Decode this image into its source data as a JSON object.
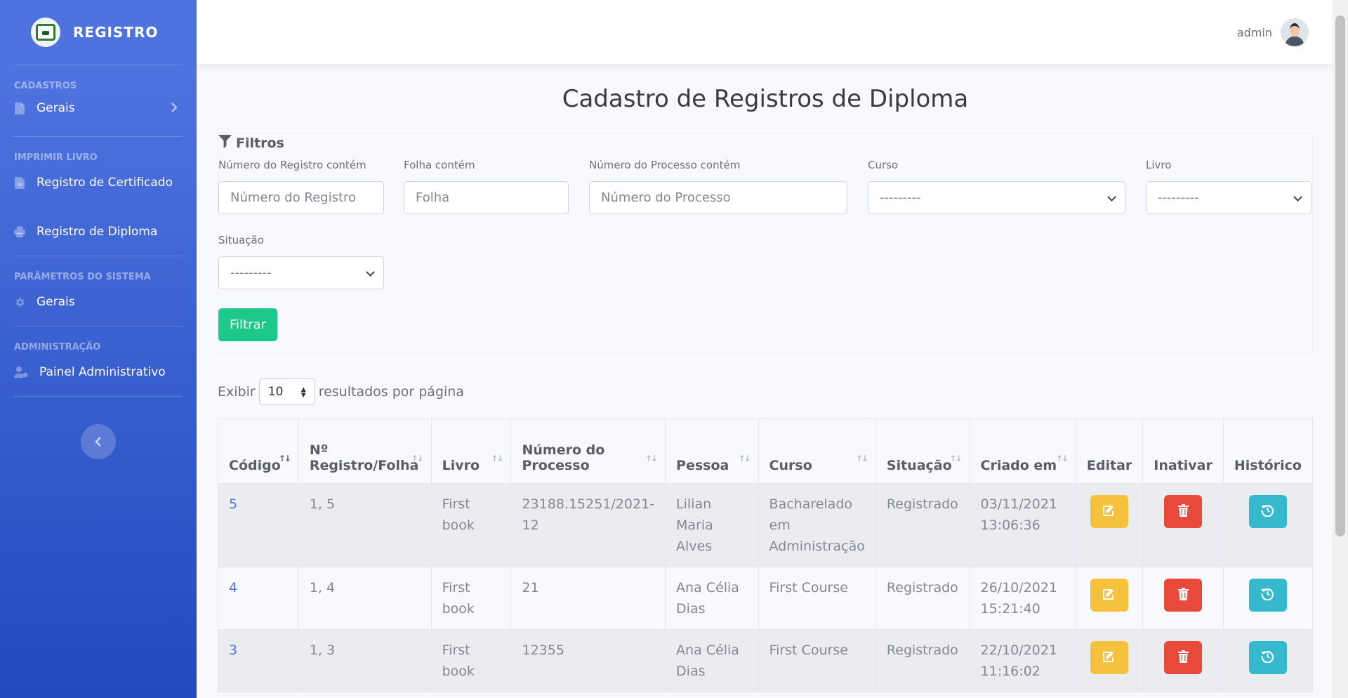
{
  "brand": {
    "name": "REGISTRO"
  },
  "sidebar": {
    "sections": [
      {
        "heading": "CADASTROS",
        "items": [
          {
            "label": "Gerais",
            "icon": "file-icon",
            "has_arrow": true
          }
        ]
      },
      {
        "heading": "IMPRIMIR LIVRO",
        "items": [
          {
            "label": "Registro de Certificado",
            "icon": "file-pdf-icon"
          },
          {
            "label": "Registro de Diploma",
            "icon": "print-icon"
          }
        ]
      },
      {
        "heading": "PARÂMETROS DO SISTEMA",
        "items": [
          {
            "label": "Gerais",
            "icon": "gear-icon"
          }
        ]
      },
      {
        "heading": "ADMINISTRAÇÃO",
        "items": [
          {
            "label": "Painel Administrativo",
            "icon": "user-cog-icon"
          }
        ]
      }
    ],
    "toggle_icon": "chevron-left-icon"
  },
  "topbar": {
    "user_name": "admin"
  },
  "page": {
    "title": "Cadastro de Registros de Diploma"
  },
  "filters": {
    "title": "Filtros",
    "numero_registro": {
      "label": "Número do Registro contém",
      "placeholder": "Número do Registro"
    },
    "folha": {
      "label": "Folha contém",
      "placeholder": "Folha"
    },
    "numero_processo": {
      "label": "Número do Processo contém",
      "placeholder": "Número do Processo"
    },
    "curso": {
      "label": "Curso",
      "value": "---------"
    },
    "livro": {
      "label": "Livro",
      "value": "---------"
    },
    "situacao": {
      "label": "Situação",
      "value": "---------"
    },
    "submit_label": "Filtrar"
  },
  "length": {
    "prefix": "Exibir",
    "value": "10",
    "suffix": "resultados por página"
  },
  "table": {
    "headers": {
      "codigo": "Código",
      "registro_1": "Nº",
      "registro_2": "Registro/Folha",
      "livro": "Livro",
      "processo_1": "Número do",
      "processo_2": "Processo",
      "pessoa": "Pessoa",
      "curso": "Curso",
      "situacao": "Situação",
      "criado": "Criado em",
      "editar": "Editar",
      "inativar": "Inativar",
      "historico": "Histórico"
    },
    "rows": [
      {
        "codigo": "5",
        "registro": "1, 5",
        "livro": "First book",
        "processo": "23188.15251/2021-12",
        "pessoa": "Lilian Maria Alves",
        "curso": "Bacharelado em Administração",
        "situacao": "Registrado",
        "criado_data": "03/11/2021",
        "criado_hora": "13:06:36"
      },
      {
        "codigo": "4",
        "registro": "1, 4",
        "livro": "First book",
        "processo": "21",
        "pessoa": "Ana Célia Dias",
        "curso": "First Course",
        "situacao": "Registrado",
        "criado_data": "26/10/2021",
        "criado_hora": "15:21:40"
      },
      {
        "codigo": "3",
        "registro": "1, 3",
        "livro": "First book",
        "processo": "12355",
        "pessoa": "Ana Célia Dias",
        "curso": "First Course",
        "situacao": "Registrado",
        "criado_data": "22/10/2021",
        "criado_hora": "11:16:02"
      }
    ]
  },
  "colors": {
    "sidebar_start": "#4e73df",
    "sidebar_end": "#224abe",
    "success": "#1cc88a",
    "warning": "#f6c23e",
    "danger": "#e74a3b",
    "info": "#36b9cc",
    "link": "#4e73df"
  }
}
